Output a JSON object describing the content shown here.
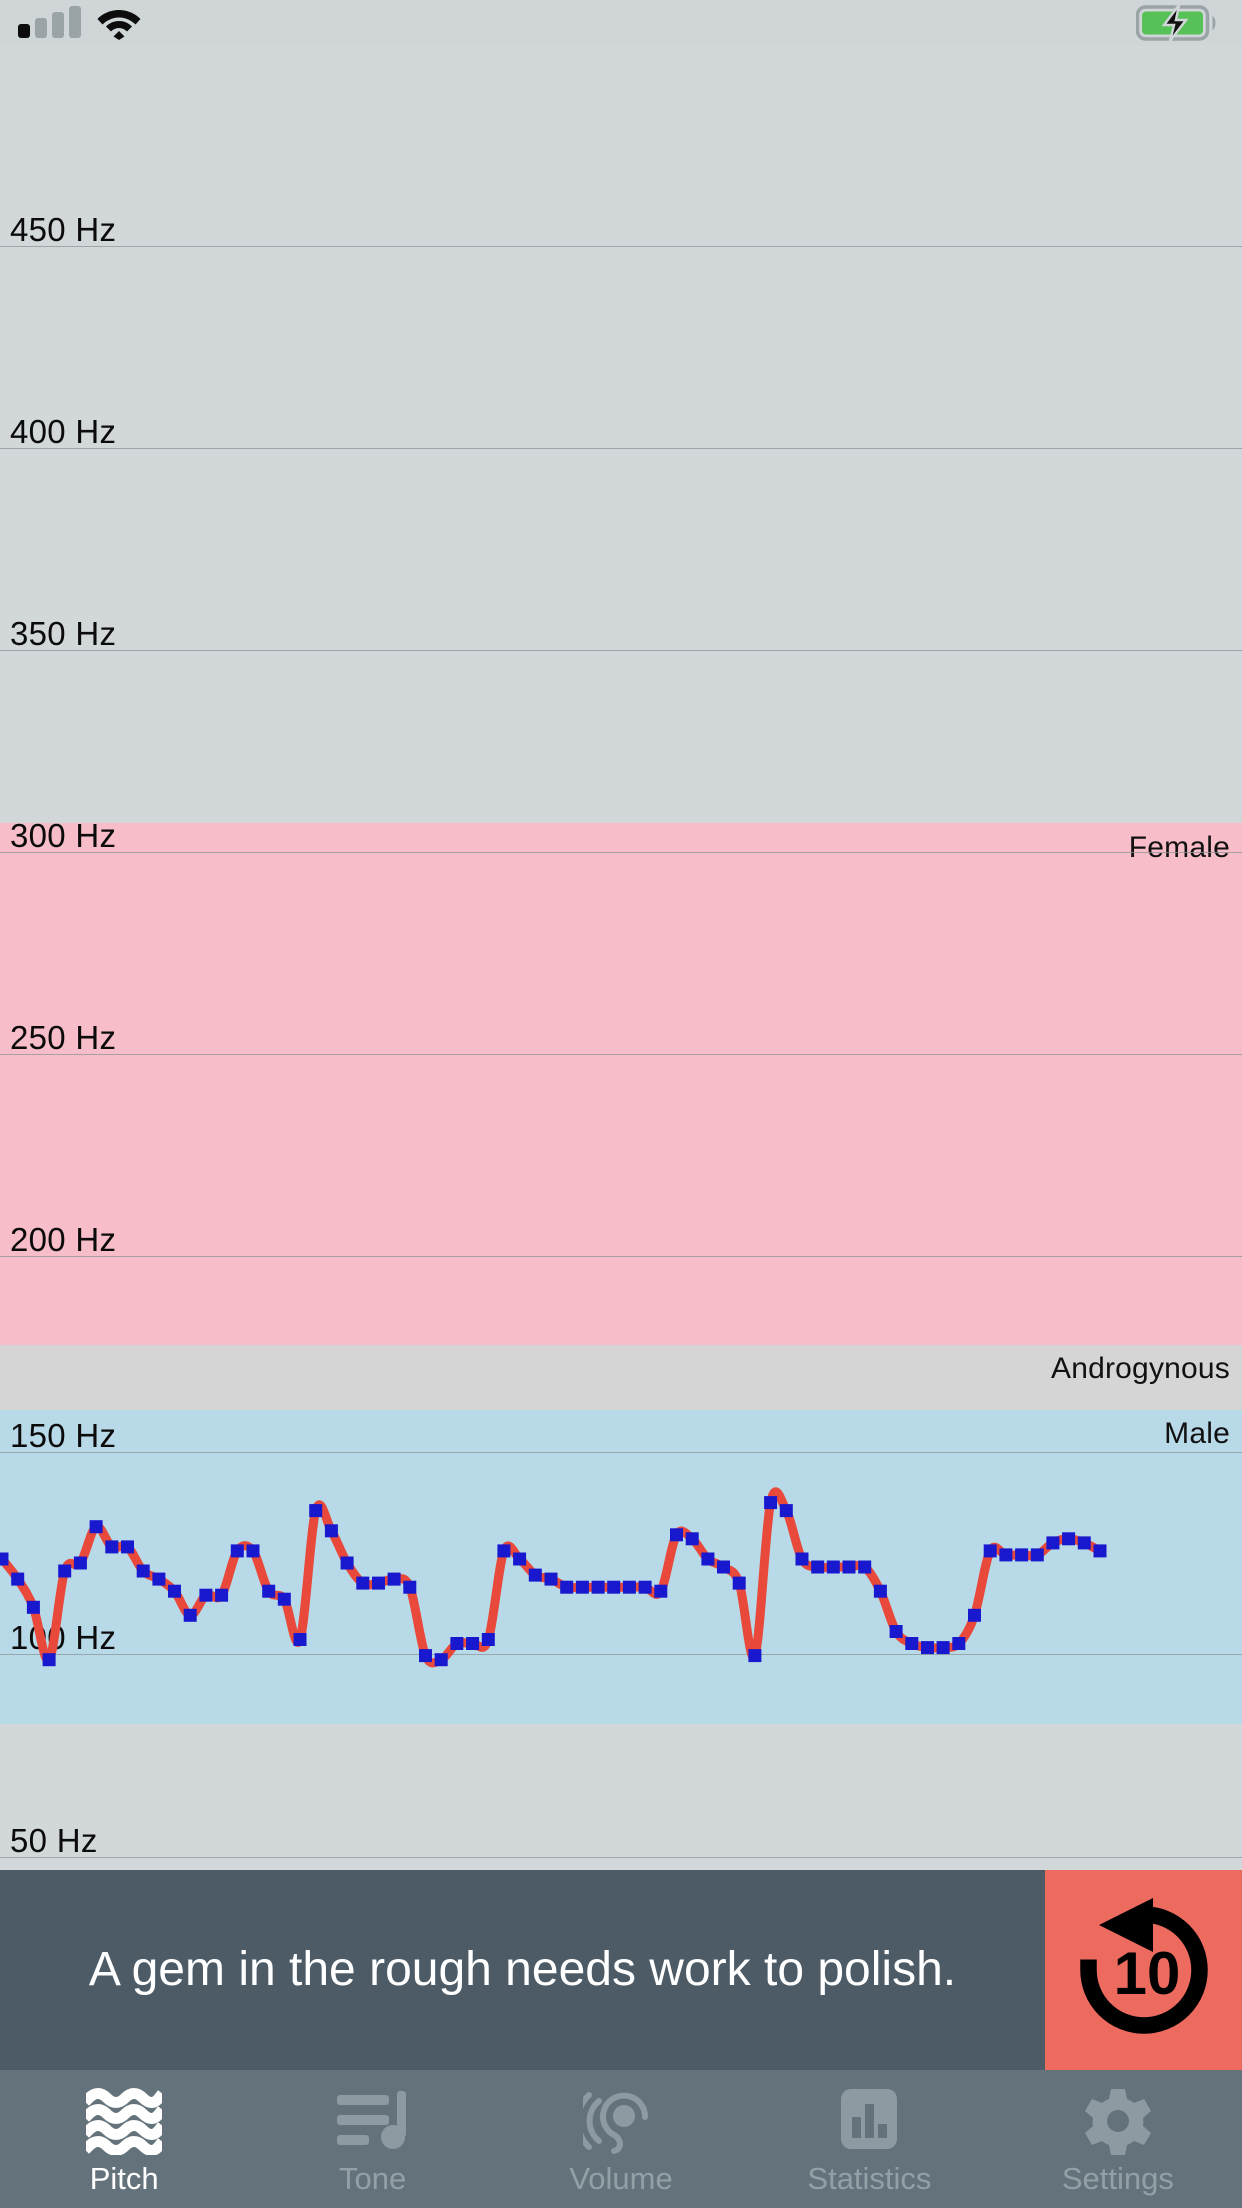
{
  "status_bar": {
    "signal_icon": "cellular-signal-icon",
    "signal_bars_filled": 1,
    "signal_bars_total": 4,
    "wifi_icon": "wifi-icon",
    "battery_icon": "battery-charging-icon",
    "battery_color": "#56c156",
    "battery_charging": true
  },
  "chart_data": {
    "type": "line",
    "title": "",
    "xlabel": "",
    "ylabel": "Hz",
    "ylim": [
      40,
      470
    ],
    "grid": true,
    "legend_position": "right-inline",
    "tick_labels": [
      "450 Hz",
      "400 Hz",
      "350 Hz",
      "300 Hz",
      "250 Hz",
      "200 Hz",
      "150 Hz",
      "100 Hz",
      "50 Hz"
    ],
    "tick_values": [
      450,
      400,
      350,
      300,
      250,
      200,
      150,
      100,
      50
    ],
    "bands": [
      {
        "name": "Female",
        "label": "Female",
        "min": 165,
        "max": 300,
        "color": "#f7bdc8"
      },
      {
        "name": "Androgynous",
        "label": "Androgynous",
        "min": 145,
        "max": 165,
        "color": "#d5d5d5"
      },
      {
        "name": "Male",
        "label": "Male",
        "min": 68,
        "max": 145,
        "color": "#b8dae8"
      }
    ],
    "series": [
      {
        "name": "Pitch",
        "line_color": "#e8493a",
        "marker_color": "#1818cf",
        "marker_shape": "square",
        "values": [
          124,
          119,
          112,
          99,
          121,
          123,
          132,
          127,
          127,
          121,
          119,
          116,
          110,
          115,
          115,
          126,
          126,
          116,
          114,
          104,
          136,
          131,
          123,
          118,
          118,
          119,
          117,
          100,
          99,
          103,
          103,
          104,
          126,
          124,
          120,
          119,
          117,
          117,
          117,
          117,
          117,
          117,
          116,
          130,
          129,
          124,
          122,
          118,
          100,
          138,
          136,
          124,
          122,
          122,
          122,
          122,
          116,
          106,
          103,
          102,
          102,
          103,
          110,
          126,
          125,
          125,
          125,
          128,
          129,
          128,
          126
        ]
      }
    ]
  },
  "caption": {
    "text": "A gem in the rough needs work to polish.",
    "background_color": "#4c5b66",
    "text_color": "#ffffff"
  },
  "rewind_button": {
    "label": "10",
    "icon": "rewind-10-icon",
    "background_color": "#ed6a5f"
  },
  "tab_bar": {
    "background_color": "#64737b",
    "active_color": "#ffffff",
    "inactive_color": "#93a0a6",
    "tabs": [
      {
        "label": "Pitch",
        "icon": "waves-icon",
        "active": true
      },
      {
        "label": "Tone",
        "icon": "music-note-list-icon",
        "active": false
      },
      {
        "label": "Volume",
        "icon": "ear-icon",
        "active": false
      },
      {
        "label": "Statistics",
        "icon": "bar-chart-icon",
        "active": false
      },
      {
        "label": "Settings",
        "icon": "gear-icon",
        "active": false
      }
    ]
  }
}
